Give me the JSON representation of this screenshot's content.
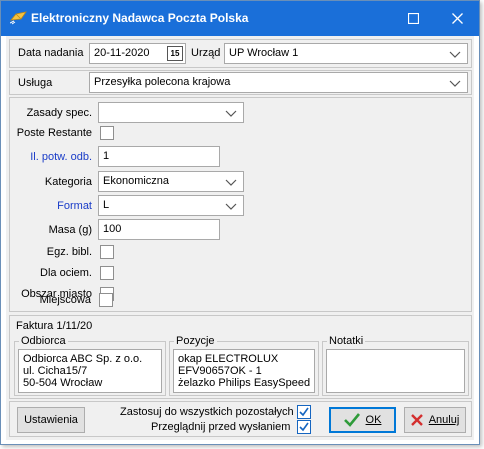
{
  "window": {
    "title": "Elektroniczny Nadawca Poczta Polska",
    "maximize_icon": "maximize-icon",
    "close_icon": "close-icon"
  },
  "header": {
    "date_label": "Data nadania",
    "date_value": "20-11-2020",
    "calendar_icon_text": "15",
    "office_label": "Urząd",
    "office_value": "UP Wrocław 1"
  },
  "service": {
    "label": "Usługa",
    "value": "Przesyłka polecona krajowa"
  },
  "form": {
    "zasady_label": "Zasady spec.",
    "zasady_value": "",
    "poste_label": "Poste Restante",
    "il_potw_label": "Il. potw. odb.",
    "il_potw_value": "1",
    "kategoria_label": "Kategoria",
    "kategoria_value": "Ekonomiczna",
    "format_label": "Format",
    "format_value": "L",
    "masa_label": "Masa (g)",
    "masa_value": "100",
    "egz_label": "Egz. bibl.",
    "dla_ociem_label": "Dla ociem.",
    "obszar_label": "Obszar miasto",
    "miejscowa_label": "Miejscowa"
  },
  "invoice": {
    "title": "Faktura 1/11/20",
    "odbiorca_legend": "Odbiorca",
    "odbiorca_lines": [
      "Odbiorca ABC Sp. z o.o.",
      "ul. Cicha15/7",
      "50-504 Wrocław"
    ],
    "pozycje_legend": "Pozycje",
    "pozycje_lines": [
      "okap ELECTROLUX",
      "EFV90657OK - 1",
      "żelazko Philips EasySpeed"
    ],
    "notatki_legend": "Notatki",
    "notatki_lines": []
  },
  "footer": {
    "settings_label": "Ustawienia",
    "apply_all_label": "Zastosuj do wszystkich pozostałych",
    "apply_all_checked": true,
    "preview_label": "Przeglądnij przed wysłaniem",
    "preview_checked": true,
    "ok_label": "OK",
    "cancel_label": "Anuluj"
  },
  "colors": {
    "titlebar": "#1a6fd9",
    "field_label_blue": "#1a3cc8",
    "ok_check": "#2e9b3a",
    "cancel_x": "#d32f2f",
    "checkbox_blue": "#1565c0"
  }
}
